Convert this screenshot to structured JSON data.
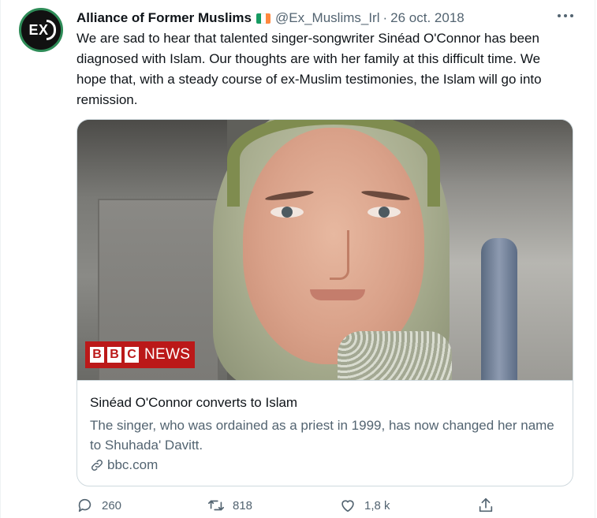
{
  "tweet": {
    "author_name": "Alliance of Former Muslims",
    "avatar_text": "EX",
    "handle": "@Ex_Muslims_Irl",
    "separator": "·",
    "date": "26 oct. 2018",
    "text": "We are sad to hear that talented singer-songwriter Sinéad O'Connor has been diagnosed with Islam. Our thoughts are with her family at this difficult time. We hope that, with a steady course of ex-Muslim testimonies, the Islam will go into remission."
  },
  "flag_colors": [
    "#169b62",
    "#ffffff",
    "#ff883e"
  ],
  "card": {
    "logo_letters": [
      "B",
      "B",
      "C"
    ],
    "logo_word": "NEWS",
    "title": "Sinéad O'Connor converts to Islam",
    "description": "The singer, who was ordained as a priest in 1999, has now changed her name to Shuhada' Davitt.",
    "domain": "bbc.com"
  },
  "actions": {
    "reply_count": "260",
    "retweet_count": "818",
    "like_count": "1,8 k"
  },
  "icons": [
    "more-icon",
    "reply-icon",
    "retweet-icon",
    "like-icon",
    "share-icon",
    "link-icon"
  ],
  "colors": {
    "text": "#0f1419",
    "secondary": "#536471",
    "border": "#cfd9de",
    "bbc_red": "#bb1919"
  }
}
